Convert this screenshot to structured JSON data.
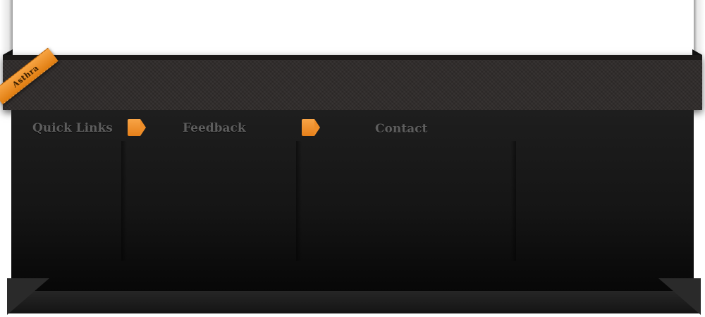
{
  "logo": {
    "text": "Asthra",
    "icon": "ribbon-logo"
  },
  "footer": {
    "columns": [
      {
        "title": "Quick Links"
      },
      {
        "title": "Feedback",
        "marker": "tag-icon"
      },
      {
        "title": "Contact",
        "marker": "tag-icon"
      }
    ]
  },
  "colors": {
    "accent": "#f39a34",
    "panel": "#151515",
    "band": "#2f2b2a",
    "heading": "#5d5d5d"
  }
}
